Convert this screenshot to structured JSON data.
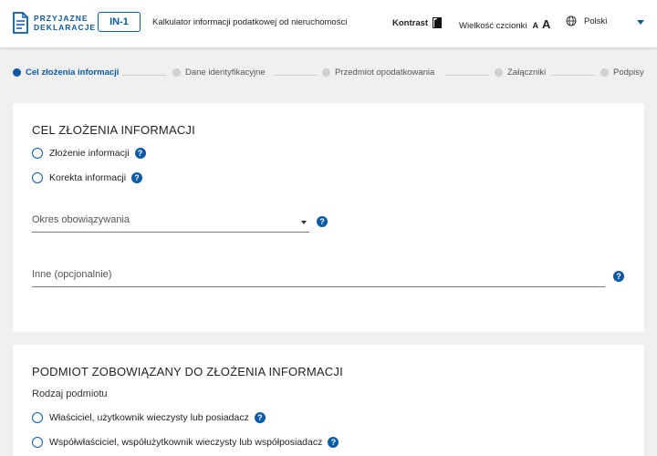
{
  "header": {
    "logo_line1": "PRZYJAZNE",
    "logo_line2": "DEKLARACJE",
    "form_code": "IN-1",
    "app_title": "Kalkulator informacji podatkowej od nieruchomości",
    "contrast_label": "Kontrast",
    "font_size_label": "Wielkość czcionki",
    "font_small": "A",
    "font_large": "A",
    "language": "Polski"
  },
  "stepper": {
    "steps": [
      {
        "label": "Cel złożenia informacji",
        "active": true
      },
      {
        "label": "Dane identyfikacyjne",
        "active": false
      },
      {
        "label": "Przedmiot opodatkowania",
        "active": false
      },
      {
        "label": "Załączniki",
        "active": false
      },
      {
        "label": "Podpisy",
        "active": false
      }
    ]
  },
  "purpose": {
    "title": "CEL ZŁOŻENIA INFORMACJI",
    "options": [
      "Złożenie informacji",
      "Korekta informacji"
    ],
    "period_placeholder": "Okres obowiązywania",
    "other_placeholder": "Inne (opcjonalnie)"
  },
  "subject": {
    "title": "PODMIOT ZOBOWIĄZANY DO ZŁOŻENIA INFORMACJI",
    "subtitle": "Rodzaj podmiotu",
    "options": [
      "Właściciel, użytkownik wieczysty lub posiadacz",
      "Współwłaściciel, współużytkownik wieczysty lub współposiadacz"
    ]
  },
  "help_glyph": "?",
  "colors": {
    "accent": "#0a5aa6",
    "inactive_step": "#cfcfcf",
    "background": "#f0f0f0"
  }
}
